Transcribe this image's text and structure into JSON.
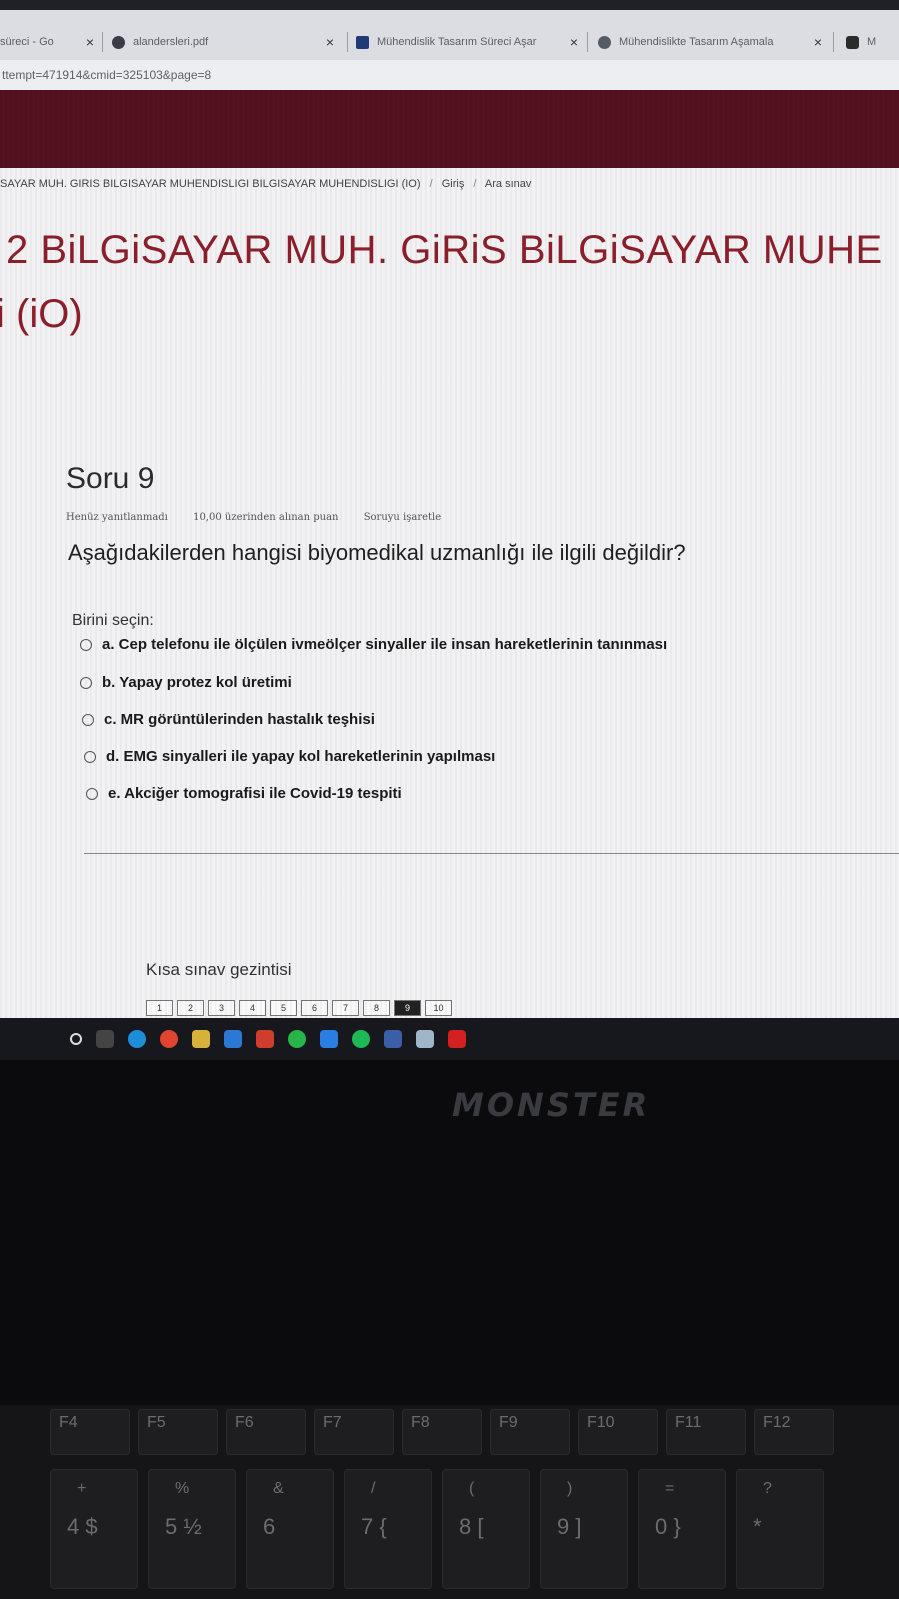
{
  "browser": {
    "tabs": [
      {
        "label": "süreci - Go",
        "close": "×"
      },
      {
        "label": "alandersleri.pdf",
        "close": "×"
      },
      {
        "label": "Mühendislik Tasarım Süreci Aşar",
        "close": "×"
      },
      {
        "label": "Mühendislikte Tasarım Aşamala",
        "close": "×"
      },
      {
        "label": "M",
        "close": ""
      }
    ],
    "url": "ttempt=471914&cmid=325103&page=8"
  },
  "breadcrumb": {
    "course": "SAYAR MUH. GIRIS BILGISAYAR MUHENDISLIGI BILGISAYAR MUHENDISLIGI (IO)",
    "section": "Giriş",
    "page": "Ara sınav",
    "separator": "/"
  },
  "course": {
    "title": "2 BiLGiSAYAR MUH. GiRiS BiLGiSAYAR MUHE",
    "subtitle": "i (iO)"
  },
  "question": {
    "title": "Soru 9",
    "status": "Henüz yanıtlanmadı",
    "points": "10,00 üzerinden alınan puan",
    "flag": "Soruyu işaretle",
    "text": "Aşağıdakilerden hangisi biyomedikal uzmanlığı ile ilgili değildir?",
    "choose_label": "Birini seçin:",
    "options": [
      "a. Cep telefonu ile ölçülen ivmeölçer sinyaller ile insan hareketlerinin tanınması",
      "b. Yapay protez kol üretimi",
      "c. MR görüntülerinden hastalık teşhisi",
      "d. EMG sinyalleri ile yapay kol hareketlerinin yapılması",
      "e. Akciğer tomografisi ile Covid-19 tespiti"
    ]
  },
  "quiz_nav": {
    "label": "Kısa sınav gezintisi",
    "pages": [
      "1",
      "2",
      "3",
      "4",
      "5",
      "6",
      "7",
      "8",
      "9",
      "10"
    ],
    "current": "9"
  },
  "laptop": {
    "brand": "MONSTER",
    "fkeys": [
      "F4",
      "F5",
      "F6",
      "F7",
      "F8",
      "F9",
      "F10",
      "F11",
      "F12"
    ],
    "numkeys": [
      {
        "top": "+",
        "main": "4 $"
      },
      {
        "top": "%",
        "main": "5 ½"
      },
      {
        "top": "&",
        "main": "6"
      },
      {
        "top": "/",
        "main": "7 {"
      },
      {
        "top": "(",
        "main": "8 ["
      },
      {
        "top": ")",
        "main": "9 ]"
      },
      {
        "top": "=",
        "main": "0 }"
      },
      {
        "top": "?",
        "main": "*"
      }
    ]
  },
  "colors": {
    "banner": "#54111f",
    "title": "#8c1f2c",
    "taskbar": "#17181d"
  }
}
